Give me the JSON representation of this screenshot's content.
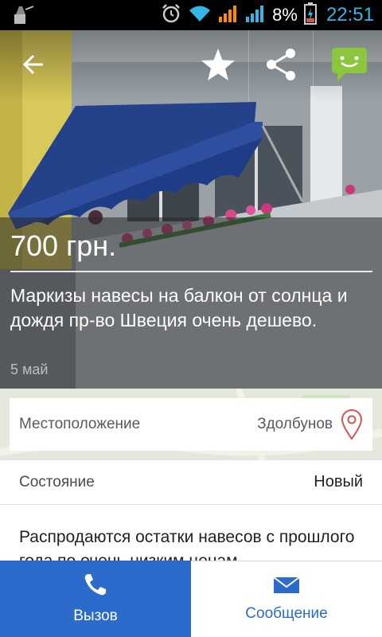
{
  "status_bar": {
    "battery_percent": "8%",
    "time": "22:51",
    "icons": [
      "cleaner-icon",
      "alarm-icon",
      "wifi-icon",
      "signal-icon",
      "signal-icon",
      "battery-charging-icon"
    ]
  },
  "toolbar": {
    "icons": [
      "back-arrow-icon",
      "star-icon",
      "share-icon",
      "chat-icon"
    ]
  },
  "listing": {
    "price": "700 грн.",
    "title": "Маркизы навесы на балкон от солнца и дождя пр-во Швеция очень дешево.",
    "date": "5 май"
  },
  "location": {
    "label": "Местоположение",
    "value": "Здолбунов"
  },
  "condition": {
    "label": "Состояние",
    "value": "Новый"
  },
  "description": "Распродаются остатки навесов с прошлого года по очень низким ценам",
  "actions": {
    "call_label": "Вызов",
    "message_label": "Сообщение"
  },
  "colors": {
    "accent_blue": "#2a6bcb",
    "time_blue": "#33b5e5",
    "chat_green": "#8cc63f",
    "pin_red": "#d9534f"
  }
}
